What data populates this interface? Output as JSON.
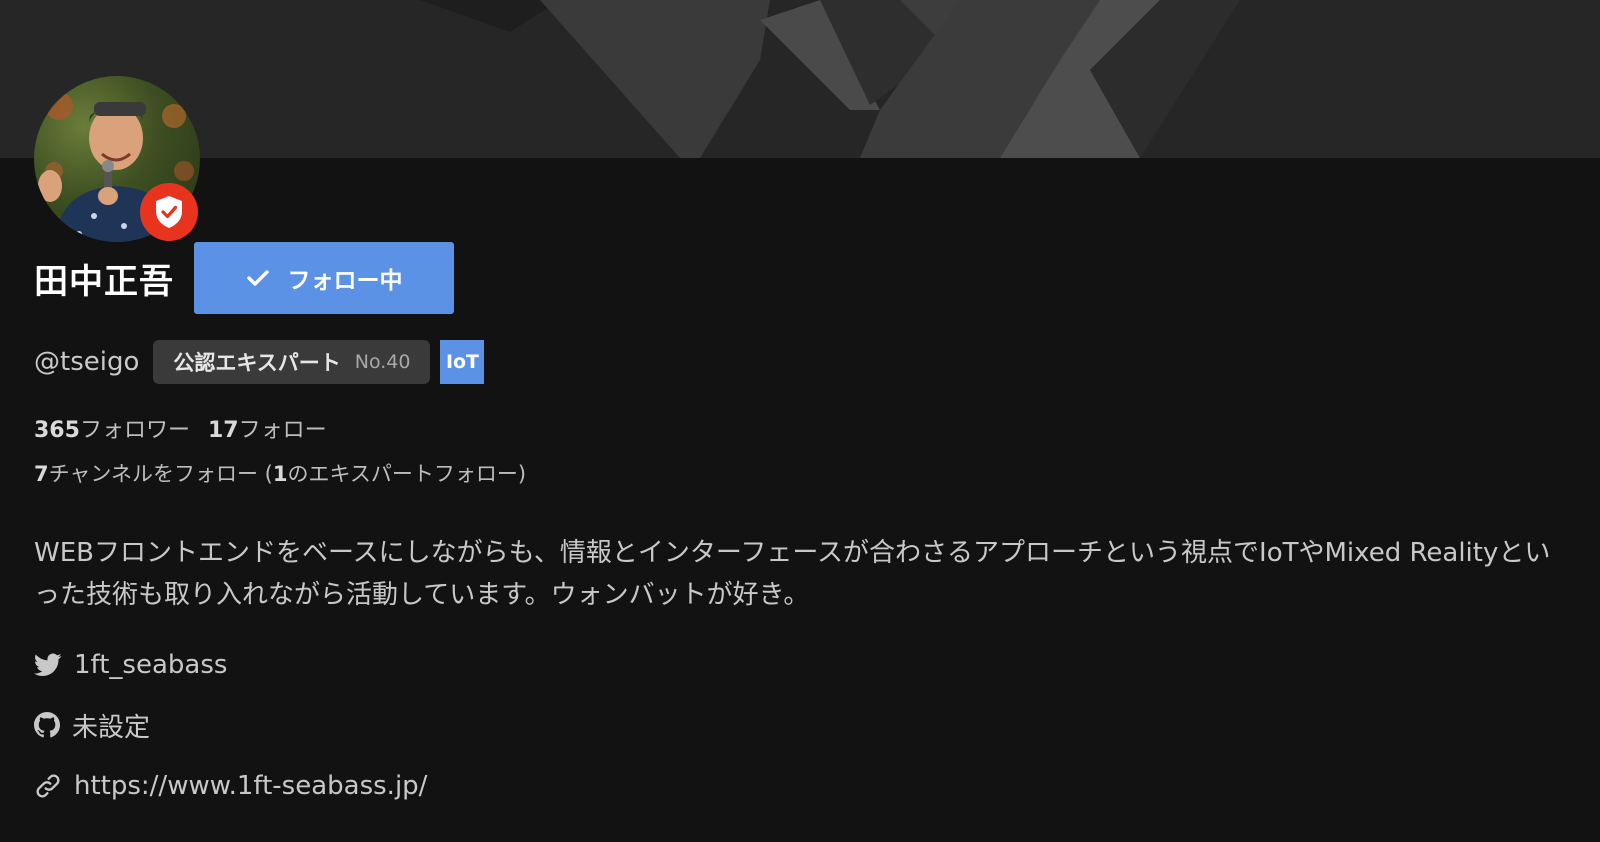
{
  "profile": {
    "name": "田中正吾",
    "follow_button_label": "フォロー中",
    "handle": "@tseigo",
    "expert": {
      "label": "公認エキスパート",
      "number": "No.40"
    },
    "tag": "IoT",
    "followers_count": "365",
    "followers_label": "フォロワー",
    "following_count": "17",
    "following_label": "フォロー",
    "channels_count": "7",
    "channels_label": "チャンネルをフォロー (",
    "expert_follow_count": "1",
    "expert_follow_label": "のエキスパートフォロー)",
    "bio": "WEBフロントエンドをベースにしながらも、情報とインターフェースが合わさるアプローチという視点でIoTやMixed Realityといった技術も取り入れながら活動しています。ウォンバットが好き。",
    "twitter": "1ft_seabass",
    "github": "未設定",
    "website": "https://www.1ft-seabass.jp/"
  },
  "colors": {
    "background": "#121212",
    "banner": "#262626",
    "accent_blue": "#5b92e5",
    "badge_red": "#e8331f",
    "chip_gray": "#3a3a3a"
  },
  "icons": [
    "verified-shield-icon",
    "check-icon",
    "twitter-icon",
    "github-icon",
    "link-icon"
  ]
}
